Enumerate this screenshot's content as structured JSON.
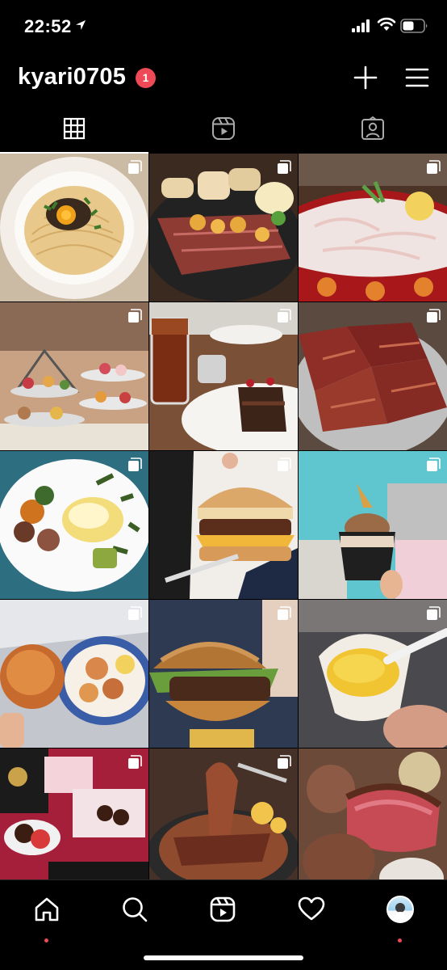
{
  "status_bar": {
    "time": "22:52"
  },
  "header": {
    "username": "kyari0705",
    "notification_count": "1"
  },
  "tabs": [
    "posts-grid",
    "reels",
    "tagged"
  ],
  "grid": {
    "posts": [
      {
        "subject": "pasta with egg yolk and seaweed",
        "multi": true
      },
      {
        "subject": "steak with sea urchin and bread",
        "multi": true
      },
      {
        "subject": "sashimi in red bowl",
        "multi": true
      },
      {
        "subject": "afternoon tea stand with sweets",
        "multi": true
      },
      {
        "subject": "iced tea and chocolate cake",
        "multi": true
      },
      {
        "subject": "grilled beef cubes",
        "multi": true
      },
      {
        "subject": "eggs benedict salad plate",
        "multi": true
      },
      {
        "subject": "cheeseburger held by hand",
        "multi": true
      },
      {
        "subject": "gelato cup",
        "multi": true
      },
      {
        "subject": "fried shrimp plate",
        "multi": true
      },
      {
        "subject": "burger with lettuce",
        "multi": true
      },
      {
        "subject": "mango gelato cup",
        "multi": true
      },
      {
        "subject": "chocolate covered strawberries box",
        "multi": true
      },
      {
        "subject": "steak and corn skillet",
        "multi": true
      },
      {
        "subject": "roast beef close-up",
        "multi": false
      }
    ]
  },
  "bottom_nav": [
    "home",
    "search",
    "reels",
    "activity",
    "profile"
  ],
  "colors": {
    "background": "#000000",
    "badge": "#ed4956",
    "text": "#ffffff"
  }
}
